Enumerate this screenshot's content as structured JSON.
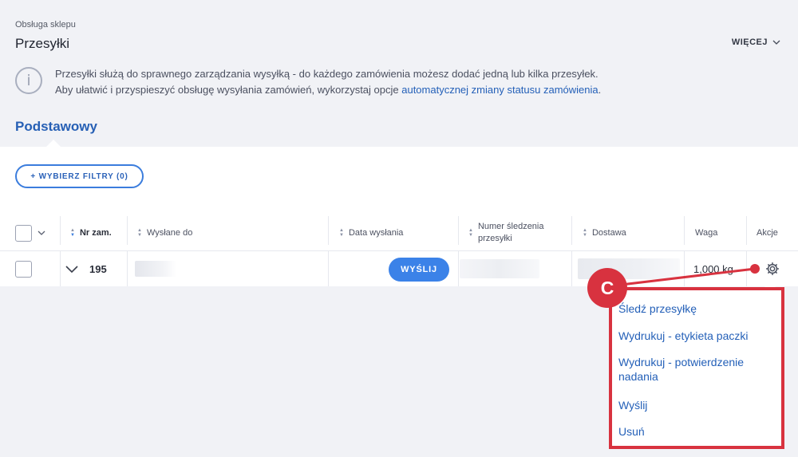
{
  "header": {
    "breadcrumb": "Obsługa sklepu",
    "title": "Przesyłki",
    "more_label": "WIĘCEJ"
  },
  "info": {
    "icon": "info-icon",
    "line1": "Przesyłki służą do sprawnego zarządzania wysyłką - do każdego zamówienia możesz dodać jedną lub kilka przesyłek.",
    "line2_prefix": "Aby ułatwić i przyspieszyć obsługę wysyłania zamówień, wykorzystaj opcje ",
    "line2_link": "automatycznej zmiany statusu zamówienia",
    "line2_suffix": "."
  },
  "tabs": {
    "active": "Podstawowy"
  },
  "filters": {
    "button_label": "+ WYBIERZ FILTRY (0)"
  },
  "table": {
    "columns": {
      "order_no": "Nr zam.",
      "sent_to": "Wysłane do",
      "send_date": "Data wysłania",
      "tracking_line1": "Numer śledzenia",
      "tracking_line2": "przesyłki",
      "delivery": "Dostawa",
      "weight": "Waga",
      "actions": "Akcje"
    },
    "rows": [
      {
        "order_no": "195",
        "send_button": "WYŚLIJ",
        "weight": "1,000 kg"
      }
    ]
  },
  "actions_menu": {
    "items": [
      "Śledź przesyłkę",
      "Wydrukuj - etykieta paczki",
      "Wydrukuj - potwierdzenie nadania",
      "Wyślij",
      "Usuń"
    ]
  },
  "callout": {
    "label": "C",
    "color": "#d8323f"
  },
  "colors": {
    "accent": "#3b82e8",
    "link": "#2460b8",
    "background": "#f1f2f6"
  }
}
